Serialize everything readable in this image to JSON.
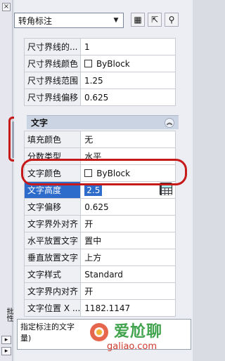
{
  "toolbar": {
    "selected_object": "转角标注",
    "select_caret": "▼",
    "btn1_label": "▦",
    "btn2_label": "⇱",
    "btn3_label": "⚲"
  },
  "left_strip": {
    "close_glyph": "×",
    "vertical_text": "批性",
    "btn_a": "▸",
    "btn_b": "▸"
  },
  "extension_props": [
    {
      "name": "尺寸界线的...",
      "value": "1"
    },
    {
      "name": "尺寸界线颜色",
      "value": "ByBlock",
      "checkbox": true
    },
    {
      "name": "尺寸界线范围",
      "value": "1.25"
    },
    {
      "name": "尺寸界线偏移",
      "value": "0.625"
    }
  ],
  "section": {
    "title": "文字",
    "collapse_glyph": "︽"
  },
  "text_props": [
    {
      "name": "填充颜色",
      "value": "无"
    },
    {
      "name": "分数类型",
      "value": "水平"
    },
    {
      "name": "文字颜色",
      "value": "ByBlock",
      "checkbox": true
    },
    {
      "name": "文字高度",
      "value": "2.5",
      "highlighted": true
    },
    {
      "name": "文字偏移",
      "value": "0.625"
    },
    {
      "name": "文字界外对齐",
      "value": "开"
    },
    {
      "name": "水平放置文字",
      "value": "置中"
    },
    {
      "name": "垂直放置文字",
      "value": "上方"
    },
    {
      "name": "文字样式",
      "value": "Standard"
    },
    {
      "name": "文字界内对齐",
      "value": "开"
    },
    {
      "name": "文字位置 X ...",
      "value": "1182.1147"
    }
  ],
  "description": {
    "text": "指定标注的文字",
    "text2": "量)"
  },
  "watermark": {
    "title": "爱尬聊",
    "url": "galiao.com"
  }
}
